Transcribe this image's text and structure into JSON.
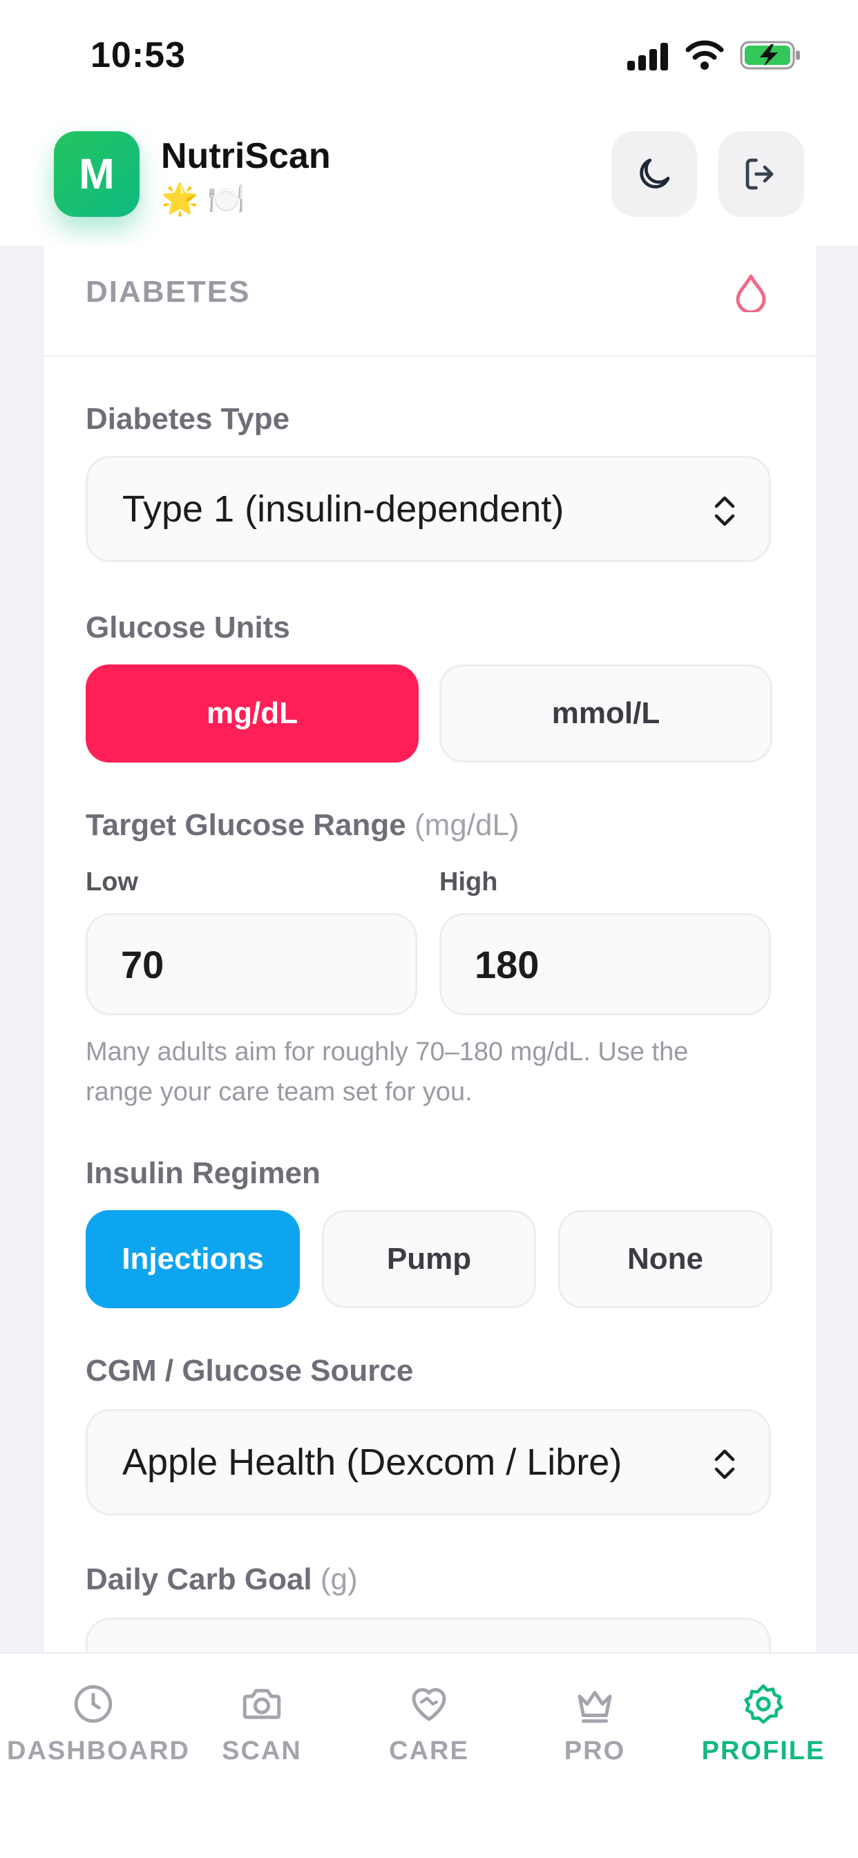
{
  "status_bar": {
    "time": "10:53"
  },
  "header": {
    "app_name": "NutriScan",
    "logo_letter": "M",
    "emojis": "🌟 🍽️"
  },
  "section": {
    "title": "DIABETES"
  },
  "diabetes_type": {
    "label": "Diabetes Type",
    "value": "Type 1 (insulin-dependent)"
  },
  "glucose_units": {
    "label": "Glucose Units",
    "options": [
      "mg/dL",
      "mmol/L"
    ],
    "selected": "mg/dL"
  },
  "target_range": {
    "label": "Target Glucose Range",
    "unit": "(mg/dL)",
    "low_label": "Low",
    "low_value": "70",
    "high_label": "High",
    "high_value": "180",
    "helper": "Many adults aim for roughly 70–180 mg/dL. Use the range your care team set for you."
  },
  "insulin_regimen": {
    "label": "Insulin Regimen",
    "options": [
      "Injections",
      "Pump",
      "None"
    ],
    "selected": "Injections"
  },
  "cgm_source": {
    "label": "CGM / Glucose Source",
    "value": "Apple Health (Dexcom / Libre)"
  },
  "carb_goal": {
    "label": "Daily Carb Goal",
    "unit": "(g)"
  },
  "tabs": [
    {
      "label": "DASHBOARD",
      "icon": "clock-icon"
    },
    {
      "label": "SCAN",
      "icon": "camera-icon"
    },
    {
      "label": "CARE",
      "icon": "heart-handshake-icon"
    },
    {
      "label": "PRO",
      "icon": "crown-icon"
    },
    {
      "label": "PROFILE",
      "icon": "gear-icon",
      "active": true
    }
  ],
  "colors": {
    "brand_green": "#10b981",
    "accent_red": "#ff1f57",
    "accent_blue": "#0ea5f0",
    "drop_icon": "#f06a86"
  }
}
